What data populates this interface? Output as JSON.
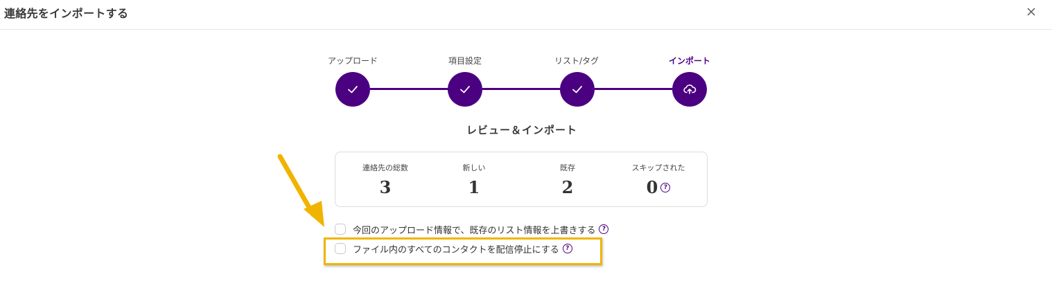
{
  "dialog": {
    "title": "連絡先をインポートする",
    "close_icon": "close-icon"
  },
  "steps": [
    {
      "label": "アップロード",
      "status": "completed",
      "icon": "check-icon"
    },
    {
      "label": "項目設定",
      "status": "completed",
      "icon": "check-icon"
    },
    {
      "label": "リスト/タグ",
      "status": "completed",
      "icon": "check-icon"
    },
    {
      "label": "インポート",
      "status": "current",
      "icon": "cloud-upload-icon"
    }
  ],
  "review": {
    "title": "レビュー＆インポート",
    "stats": [
      {
        "label": "連絡先の総数",
        "value": "3"
      },
      {
        "label": "新しい",
        "value": "1"
      },
      {
        "label": "既存",
        "value": "2"
      },
      {
        "label": "スキップされた",
        "value": "0"
      }
    ]
  },
  "options": [
    {
      "label": "今回のアップロード情報で、既存のリスト情報を上書きする",
      "checked": false
    },
    {
      "label": "ファイル内のすべてのコンタクトを配信停止にする",
      "checked": false
    }
  ],
  "help_symbol": "?",
  "colors": {
    "accent": "#4b0082",
    "annotation": "#f0b400",
    "border": "#dcdcdc"
  }
}
